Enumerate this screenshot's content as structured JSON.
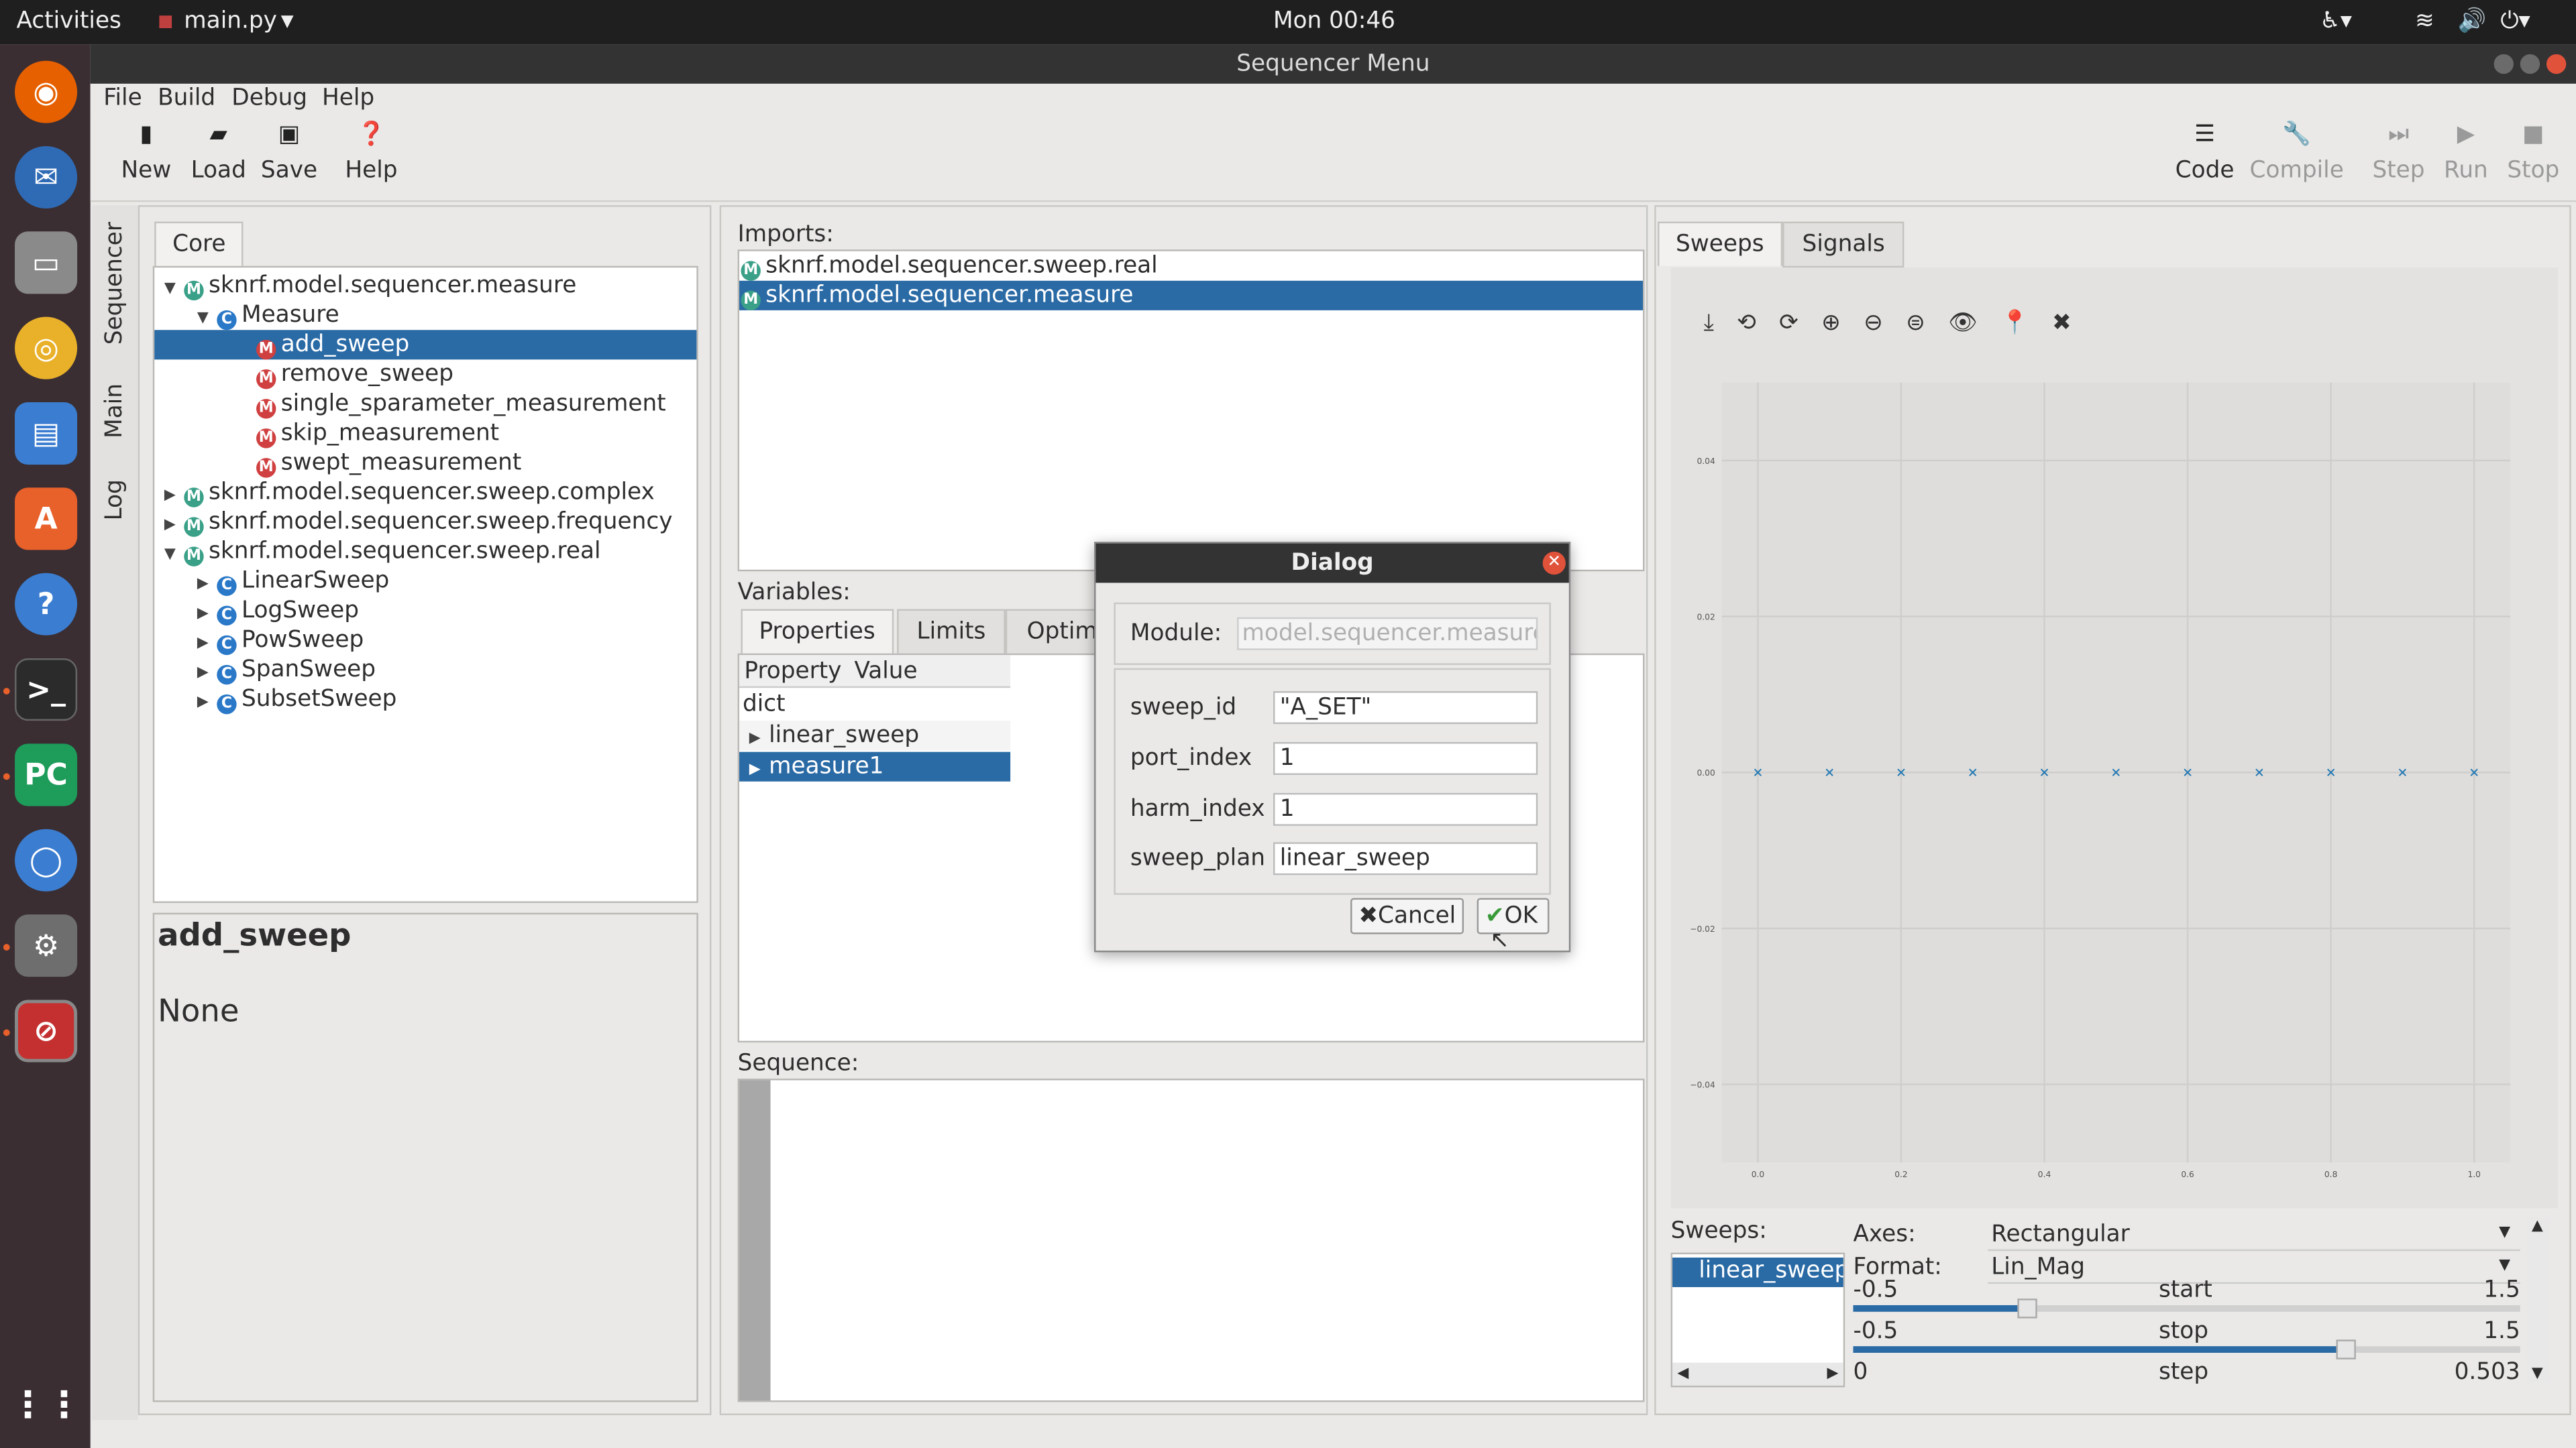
{
  "topbar": {
    "activities": "Activities",
    "app_menu": "main.py",
    "clock": "Mon 00:46"
  },
  "window": {
    "title": "Sequencer Menu"
  },
  "menu": {
    "file": "File",
    "build": "Build",
    "debug": "Debug",
    "help": "Help"
  },
  "toolbar": {
    "new": "New",
    "load": "Load",
    "save": "Save",
    "help": "Help",
    "code": "Code",
    "compile": "Compile",
    "step": "Step",
    "run": "Run",
    "stop": "Stop"
  },
  "side_tabs": {
    "sequencer": "Sequencer",
    "main": "Main",
    "log": "Log"
  },
  "core": {
    "tab": "Core",
    "tree": [
      "sknrf.model.sequencer.measure",
      "Measure",
      "add_sweep",
      "remove_sweep",
      "single_sparameter_measurement",
      "skip_measurement",
      "swept_measurement",
      "sknrf.model.sequencer.sweep.complex",
      "sknrf.model.sequencer.sweep.frequency",
      "sknrf.model.sequencer.sweep.real",
      "LinearSweep",
      "LogSweep",
      "PowSweep",
      "SpanSweep",
      "SubsetSweep"
    ],
    "doc_title": "add_sweep",
    "doc_body": "None"
  },
  "imports": {
    "label": "Imports:",
    "items": [
      "sknrf.model.sequencer.sweep.real",
      "sknrf.model.sequencer.measure"
    ]
  },
  "variables": {
    "label": "Variables:",
    "tabs": [
      "Properties",
      "Limits",
      "Optim"
    ],
    "headers": [
      "Property",
      "Value"
    ],
    "rows": [
      "dict",
      "linear_sweep",
      "measure1"
    ]
  },
  "sequence": {
    "label": "Sequence:"
  },
  "dialog": {
    "title": "Dialog",
    "module_label": "Module:",
    "module_value": "model.sequencer.measure",
    "fields": [
      {
        "label": "sweep_id",
        "value": "\"A_SET\""
      },
      {
        "label": "port_index",
        "value": "1"
      },
      {
        "label": "harm_index",
        "value": "1"
      },
      {
        "label": "sweep_plan",
        "value": "linear_sweep"
      }
    ],
    "cancel": "Cancel",
    "ok": "OK"
  },
  "right": {
    "tabs": [
      "Sweeps",
      "Signals"
    ],
    "yticks": [
      "0.04",
      "0.02",
      "0.00",
      "−0.02",
      "−0.04"
    ],
    "xticks": [
      "0.0",
      "0.2",
      "0.4",
      "0.6",
      "0.8",
      "1.0"
    ],
    "sweeps_label": "Sweeps:",
    "sweep_item": "linear_sweep",
    "axes_label": "Axes:",
    "axes_value": "Rectangular",
    "format_label": "Format:",
    "format_value": "Lin_Mag",
    "sliders": [
      {
        "min": "-0.5",
        "name": "start",
        "max": "1.5"
      },
      {
        "min": "-0.5",
        "name": "stop",
        "max": "1.5"
      },
      {
        "min": "0",
        "name": "step",
        "max": "0.503"
      }
    ]
  },
  "chart_data": {
    "type": "scatter",
    "x": [
      0.0,
      0.1,
      0.2,
      0.3,
      0.4,
      0.5,
      0.6,
      0.7,
      0.8,
      0.9,
      1.0
    ],
    "series": [
      {
        "values": [
          0,
          0,
          0,
          0,
          0,
          0,
          0,
          0,
          0,
          0,
          0
        ]
      }
    ],
    "xlim": [
      0.0,
      1.0
    ],
    "ylim": [
      -0.05,
      0.05
    ],
    "color": "#1f77b4"
  }
}
